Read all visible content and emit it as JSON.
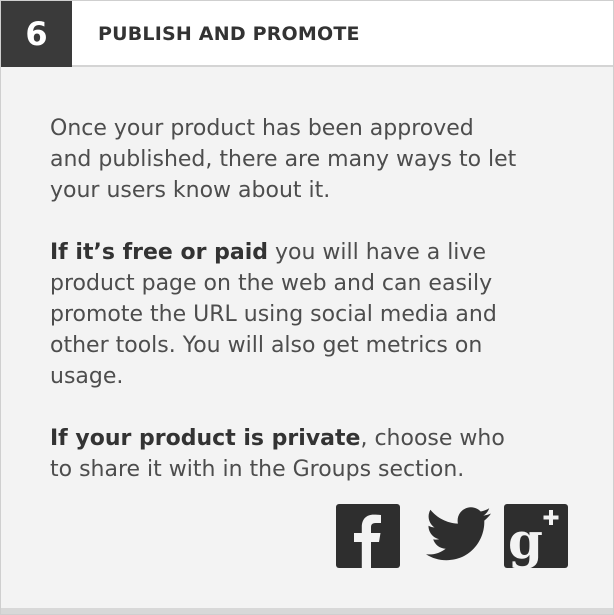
{
  "step": {
    "number": "6",
    "title": "PUBLISH AND PROMOTE"
  },
  "content": {
    "paragraph1": "Once your product has been approved and published, there are many ways to let your users know about it.",
    "paragraph2_bold": "If it’s free or paid",
    "paragraph2_rest": " you will have a live product page on the web and can easily promote the URL using social media and other tools. You will also get metrics on usage.",
    "paragraph3_bold": "If your product is private",
    "paragraph3_rest": ", choose who to share it with in the Groups section."
  },
  "social": {
    "icons": [
      "facebook-icon",
      "twitter-icon",
      "google-plus-icon"
    ]
  },
  "colors": {
    "step_badge": "#3a3a3a",
    "header_bg": "#ffffff",
    "card_bg": "#f3f3f3",
    "icon": "#2e2e2e"
  }
}
